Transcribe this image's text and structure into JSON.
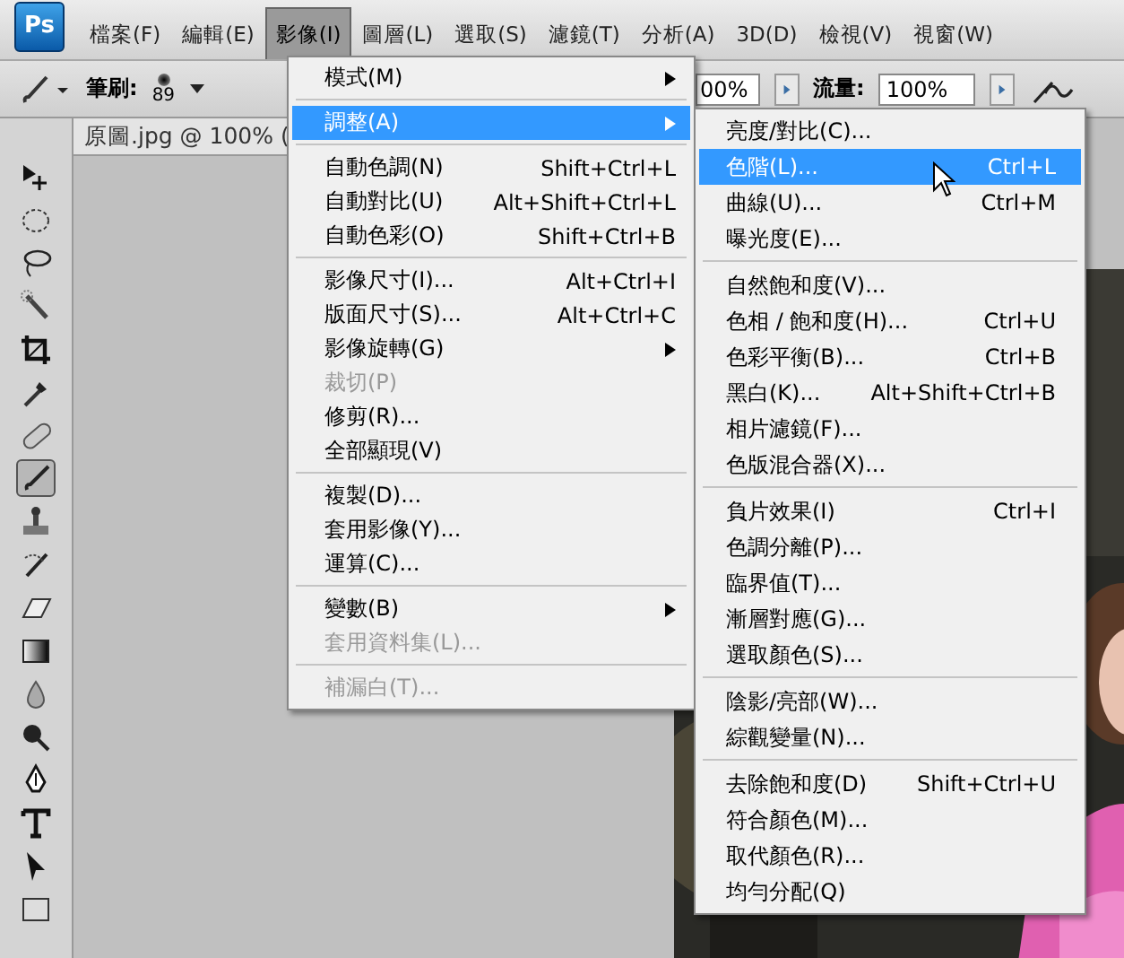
{
  "app_logo": "Ps",
  "menubar": [
    {
      "label": "檔案(F)",
      "selected": false
    },
    {
      "label": "編輯(E)",
      "selected": false
    },
    {
      "label": "影像(I)",
      "selected": true
    },
    {
      "label": "圖層(L)",
      "selected": false
    },
    {
      "label": "選取(S)",
      "selected": false
    },
    {
      "label": "濾鏡(T)",
      "selected": false
    },
    {
      "label": "分析(A)",
      "selected": false
    },
    {
      "label": "3D(D)",
      "selected": false
    },
    {
      "label": "檢視(V)",
      "selected": false
    },
    {
      "label": "視窗(W)",
      "selected": false
    }
  ],
  "options_bar": {
    "brush_label": "筆刷:",
    "brush_size": "89",
    "opacity_value": "00%",
    "flow_label": "流量:",
    "flow_value": "100%"
  },
  "document_tab": "原圖.jpg @ 100% (",
  "tools": [
    {
      "kind": "move",
      "selected": false
    },
    {
      "kind": "marquee",
      "selected": false
    },
    {
      "kind": "lasso",
      "selected": false
    },
    {
      "kind": "wand",
      "selected": false
    },
    {
      "kind": "crop",
      "selected": false
    },
    {
      "kind": "eyedropper",
      "selected": false
    },
    {
      "kind": "heal",
      "selected": false
    },
    {
      "kind": "brush",
      "selected": true
    },
    {
      "kind": "stamp",
      "selected": false
    },
    {
      "kind": "history",
      "selected": false
    },
    {
      "kind": "eraser",
      "selected": false
    },
    {
      "kind": "gradient",
      "selected": false
    },
    {
      "kind": "blur",
      "selected": false
    },
    {
      "kind": "dodge",
      "selected": false
    },
    {
      "kind": "pen",
      "selected": false
    },
    {
      "kind": "type",
      "selected": false
    },
    {
      "kind": "select",
      "selected": false
    },
    {
      "kind": "shape",
      "selected": false
    }
  ],
  "image_menu": [
    [
      {
        "label": "模式(M)",
        "submenu": true,
        "selected": false,
        "disabled": false
      }
    ],
    [
      {
        "label": "調整(A)",
        "submenu": true,
        "selected": true,
        "disabled": false
      }
    ],
    [
      {
        "label": "自動色調(N)",
        "shortcut": "Shift+Ctrl+L",
        "submenu": false,
        "selected": false,
        "disabled": false
      },
      {
        "label": "自動對比(U)",
        "shortcut": "Alt+Shift+Ctrl+L",
        "submenu": false,
        "selected": false,
        "disabled": false
      },
      {
        "label": "自動色彩(O)",
        "shortcut": "Shift+Ctrl+B",
        "submenu": false,
        "selected": false,
        "disabled": false
      }
    ],
    [
      {
        "label": "影像尺寸(I)...",
        "shortcut": "Alt+Ctrl+I",
        "submenu": false,
        "selected": false,
        "disabled": false
      },
      {
        "label": "版面尺寸(S)...",
        "shortcut": "Alt+Ctrl+C",
        "submenu": false,
        "selected": false,
        "disabled": false
      },
      {
        "label": "影像旋轉(G)",
        "submenu": true,
        "selected": false,
        "disabled": false
      },
      {
        "label": "裁切(P)",
        "submenu": false,
        "selected": false,
        "disabled": true
      },
      {
        "label": "修剪(R)...",
        "submenu": false,
        "selected": false,
        "disabled": false
      },
      {
        "label": "全部顯現(V)",
        "submenu": false,
        "selected": false,
        "disabled": false
      }
    ],
    [
      {
        "label": "複製(D)...",
        "submenu": false,
        "selected": false,
        "disabled": false
      },
      {
        "label": "套用影像(Y)...",
        "submenu": false,
        "selected": false,
        "disabled": false
      },
      {
        "label": "運算(C)...",
        "submenu": false,
        "selected": false,
        "disabled": false
      }
    ],
    [
      {
        "label": "變數(B)",
        "submenu": true,
        "selected": false,
        "disabled": false
      },
      {
        "label": "套用資料集(L)...",
        "submenu": false,
        "selected": false,
        "disabled": true
      }
    ],
    [
      {
        "label": "補漏白(T)...",
        "submenu": false,
        "selected": false,
        "disabled": true
      }
    ]
  ],
  "adjust_submenu": [
    [
      {
        "label": "亮度/對比(C)...",
        "selected": false
      },
      {
        "label": "色階(L)...",
        "shortcut": "Ctrl+L",
        "selected": true
      },
      {
        "label": "曲線(U)...",
        "shortcut": "Ctrl+M",
        "selected": false
      },
      {
        "label": "曝光度(E)...",
        "selected": false
      }
    ],
    [
      {
        "label": "自然飽和度(V)...",
        "selected": false
      },
      {
        "label": "色相 / 飽和度(H)...",
        "shortcut": "Ctrl+U",
        "selected": false
      },
      {
        "label": "色彩平衡(B)...",
        "shortcut": "Ctrl+B",
        "selected": false
      },
      {
        "label": "黑白(K)...",
        "shortcut": "Alt+Shift+Ctrl+B",
        "selected": false
      },
      {
        "label": "相片濾鏡(F)...",
        "selected": false
      },
      {
        "label": "色版混合器(X)...",
        "selected": false
      }
    ],
    [
      {
        "label": "負片效果(I)",
        "shortcut": "Ctrl+I",
        "selected": false
      },
      {
        "label": "色調分離(P)...",
        "selected": false
      },
      {
        "label": "臨界值(T)...",
        "selected": false
      },
      {
        "label": "漸層對應(G)...",
        "selected": false
      },
      {
        "label": "選取顏色(S)...",
        "selected": false
      }
    ],
    [
      {
        "label": "陰影/亮部(W)...",
        "selected": false
      },
      {
        "label": "綜觀變量(N)...",
        "selected": false
      }
    ],
    [
      {
        "label": "去除飽和度(D)",
        "shortcut": "Shift+Ctrl+U",
        "selected": false
      },
      {
        "label": "符合顏色(M)...",
        "selected": false
      },
      {
        "label": "取代顏色(R)...",
        "selected": false
      },
      {
        "label": "均勻分配(Q)",
        "selected": false
      }
    ]
  ]
}
